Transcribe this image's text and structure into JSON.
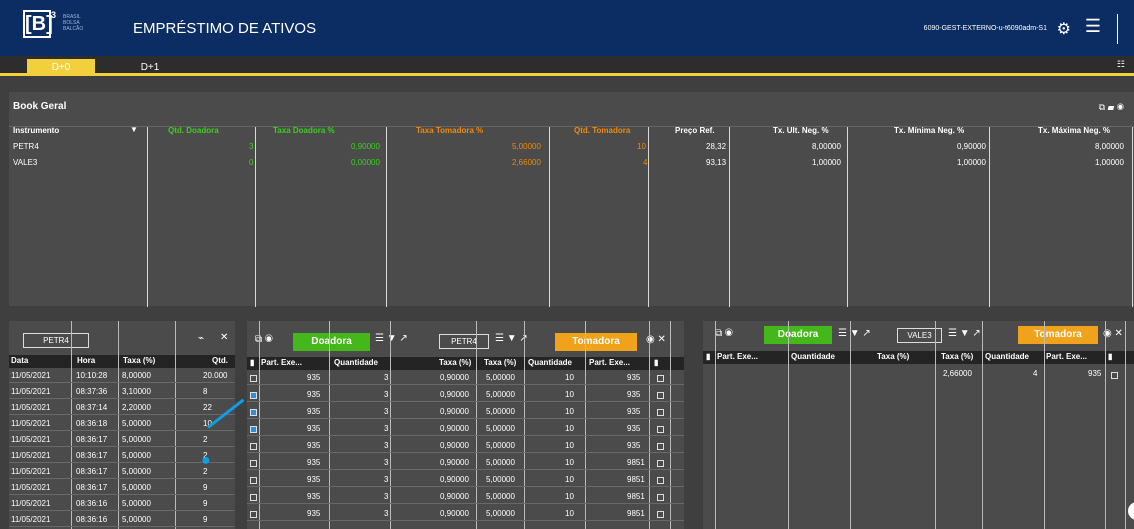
{
  "header": {
    "logo_text": "[B]",
    "logo_sup": "3",
    "logo_subtitle_1": "BRASIL",
    "logo_subtitle_2": "BOLSA",
    "logo_subtitle_3": "BALCÃO",
    "title": "EMPRÉSTIMO DE ATIVOS",
    "user": "6090-GEST-EXTERNO-u-t6090adm-S1"
  },
  "tabs": [
    "D+0",
    "D+1"
  ],
  "book": {
    "title": "Book Geral",
    "columns": [
      "Instrumento",
      "Qtd. Doadora",
      "Taxa Doadora %",
      "Taxa Tomadora %",
      "Qtd. Tomadora",
      "Preço Ref.",
      "Tx. Ult. Neg. %",
      "Tx. Mínima Neg. %",
      "Tx. Máxima Neg. %"
    ],
    "rows": [
      [
        "PETR4",
        "3",
        "0,90000",
        "5,00000",
        "10",
        "28,32",
        "8,00000",
        "0,90000",
        "8,00000"
      ],
      [
        "VALE3",
        "0",
        "0,00000",
        "2,66000",
        "4",
        "93,13",
        "1,00000",
        "1,00000",
        "1,00000"
      ]
    ]
  },
  "trades": {
    "symbol": "PETR4",
    "columns": [
      "Data",
      "Hora",
      "Taxa (%)",
      "Qtd."
    ],
    "rows": [
      [
        "11/05/2021",
        "10:10:28",
        "8,00000",
        "20.000"
      ],
      [
        "11/05/2021",
        "08:37:36",
        "3,10000",
        "8"
      ],
      [
        "11/05/2021",
        "08:37:14",
        "2,20000",
        "22"
      ],
      [
        "11/05/2021",
        "08:36:18",
        "5,00000",
        "10"
      ],
      [
        "11/05/2021",
        "08:36:17",
        "5,00000",
        "2"
      ],
      [
        "11/05/2021",
        "08:36:17",
        "5,00000",
        "2"
      ],
      [
        "11/05/2021",
        "08:36:17",
        "5,00000",
        "2"
      ],
      [
        "11/05/2021",
        "08:36:17",
        "5,00000",
        "9"
      ],
      [
        "11/05/2021",
        "08:36:16",
        "5,00000",
        "9"
      ],
      [
        "11/05/2021",
        "08:36:16",
        "5,00000",
        "9"
      ]
    ]
  },
  "order_left": {
    "doadora": "Doadora",
    "tomadora": "Tomadora",
    "symbol": "PETR4",
    "columns": [
      "Part. Exe...",
      "Quantidade",
      "Taxa (%)",
      "Taxa (%)",
      "Quantidade",
      "Part. Exe..."
    ],
    "rows": [
      [
        "935",
        "3",
        "0,90000",
        "5,00000",
        "10",
        "935"
      ],
      [
        "935",
        "3",
        "0,90000",
        "5,00000",
        "10",
        "935"
      ],
      [
        "935",
        "3",
        "0,90000",
        "5,00000",
        "10",
        "935"
      ],
      [
        "935",
        "3",
        "0,90000",
        "5,00000",
        "10",
        "935"
      ],
      [
        "935",
        "3",
        "0,90000",
        "5,00000",
        "10",
        "935"
      ],
      [
        "935",
        "3",
        "0,90000",
        "5,00000",
        "10",
        "9851"
      ],
      [
        "935",
        "3",
        "0,90000",
        "5,00000",
        "10",
        "9851"
      ],
      [
        "935",
        "3",
        "0,90000",
        "5,00000",
        "10",
        "9851"
      ],
      [
        "935",
        "3",
        "0,90000",
        "5,00000",
        "10",
        "9851"
      ]
    ]
  },
  "order_right": {
    "doadora": "Doadora",
    "tomadora": "Tomadora",
    "symbol": "VALE3",
    "columns": [
      "Part. Exe...",
      "Quantidade",
      "Taxa (%)",
      "Taxa (%)",
      "Quantidade",
      "Part. Exe..."
    ],
    "row": [
      "2,66000",
      "4",
      "935"
    ]
  }
}
